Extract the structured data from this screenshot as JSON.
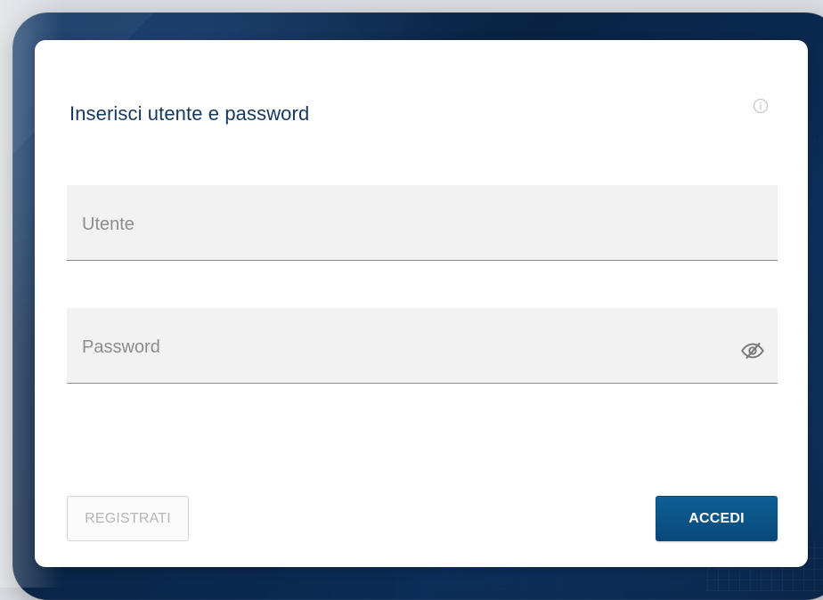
{
  "login": {
    "title": "Inserisci utente e password",
    "username": {
      "placeholder": "Utente",
      "value": ""
    },
    "password": {
      "placeholder": "Password",
      "value": ""
    },
    "buttons": {
      "register": "REGISTRATI",
      "submit": "ACCEDI"
    }
  },
  "icons": {
    "info": "info-icon",
    "password_visibility": "eye-off-icon"
  },
  "colors": {
    "title": "#17375e",
    "primary_button": "#0a5689",
    "field_background": "#f2f2f2",
    "field_border": "#8b8b8b",
    "frame_background": "#0a2344"
  }
}
